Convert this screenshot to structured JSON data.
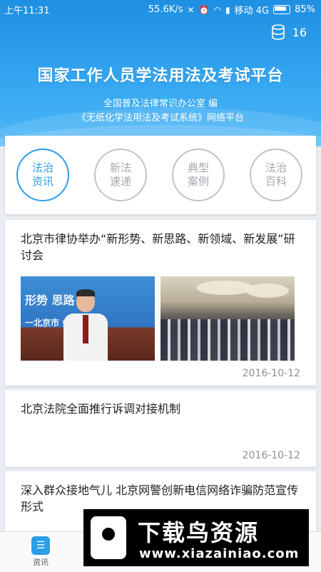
{
  "status_bar": {
    "time": "上午11:31",
    "speed": "55.6K/s",
    "carrier": "移动 4G",
    "battery": "85%"
  },
  "header": {
    "counter_value": "16",
    "title": "国家工作人员学法用法及考试平台",
    "subtitle_line1": "全国普及法律常识办公室 编",
    "subtitle_line2": "《无纸化学法用法及考试系统》网络平台"
  },
  "categories": [
    {
      "label": "法治资讯",
      "active": true
    },
    {
      "label": "新法速递",
      "active": false
    },
    {
      "label": "典型案例",
      "active": false
    },
    {
      "label": "法治百科",
      "active": false
    }
  ],
  "news": [
    {
      "headline": "北京市律协举办“新形势、新思路、新领域、新发展”研讨会",
      "date": "2016-10-12",
      "image1_text": "形势  思路",
      "image1_text2": "一北京市    会业务拓展"
    },
    {
      "headline": "北京法院全面推行诉调对接机制",
      "date": "2016-10-12"
    },
    {
      "headline": "深入群众接地气儿 北京网警创新电信网络诈骗防范宣传形式"
    }
  ],
  "watermark": {
    "title": "下载鸟资源",
    "url": "www.xiazainiao.com"
  },
  "bottom_nav": {
    "item1_label": "资讯",
    "item1_icon": "news-icon"
  },
  "colors": {
    "accent": "#2c9de8",
    "header_top": "#1f8fe2",
    "header_bottom": "#4cb7f7"
  }
}
